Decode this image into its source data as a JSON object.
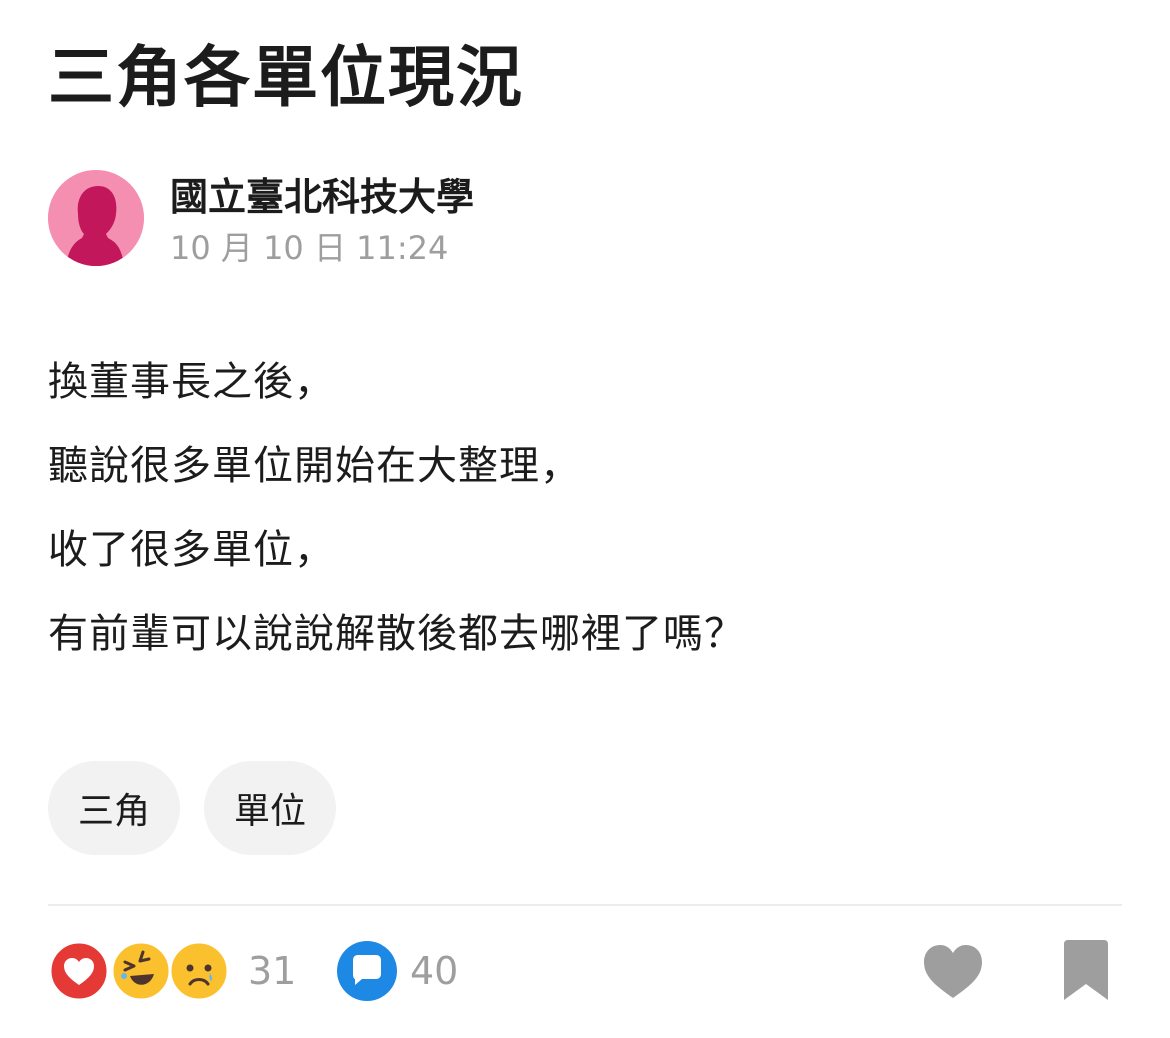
{
  "post": {
    "title": "三角各單位現況",
    "author": {
      "name": "國立臺北科技大學",
      "time": "10 月 10 日 11:24",
      "avatar_icon": "female-silhouette-icon"
    },
    "content_lines": [
      "換董事長之後，",
      "聽說很多單位開始在大整理，",
      "收了很多單位，",
      "有前輩可以說說解散後都去哪裡了嗎？"
    ],
    "tags": [
      "三角",
      "單位"
    ]
  },
  "actions": {
    "reactions": {
      "icons": [
        "heart-reaction-icon",
        "laugh-reaction-icon",
        "sad-reaction-icon"
      ],
      "count": "31"
    },
    "comments": {
      "icon": "comment-bubble-icon",
      "count": "40"
    },
    "like_icon": "heart-icon",
    "bookmark_icon": "bookmark-icon"
  },
  "colors": {
    "avatar_bg": "#f48fb1",
    "avatar_figure": "#c2185b",
    "heart_reaction": "#e53935",
    "emoji_yellow": "#fbc02d",
    "comment_blue": "#1e88e5",
    "muted_text": "#9e9e9e",
    "icon_gray": "#9e9e9e",
    "tag_bg": "#f2f2f2"
  }
}
